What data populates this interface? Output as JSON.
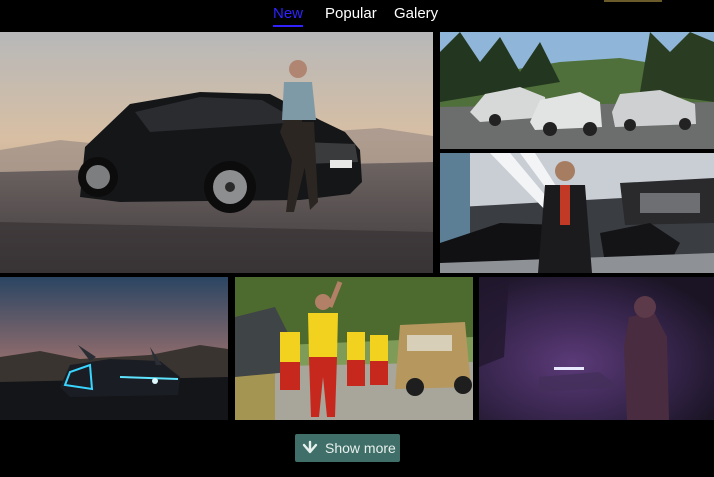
{
  "nav": {
    "tabs": [
      {
        "label": "New",
        "active": true
      },
      {
        "label": "Popular",
        "active": false
      },
      {
        "label": "Galery",
        "active": false
      }
    ],
    "active_color": "#2f22ff"
  },
  "gallery": {
    "tiles": [
      {
        "subject": "black SUV coupe with man leaning on it at sunset",
        "plate": "S MB 2020"
      },
      {
        "subject": "three camouflaged prototype cars on a mountain road"
      },
      {
        "subject": "man in black jacket in a car showroom"
      },
      {
        "subject": "concept car with glowing blue lights at dusk"
      },
      {
        "subject": "rescue team in yellow taking a selfie with an off-road vehicle",
        "plate": "S MB 6080"
      },
      {
        "subject": "person in purple misty forest with a car in the distance"
      }
    ]
  },
  "footer": {
    "show_more_label": "Show more",
    "show_more_icon": "arrow-down-icon",
    "button_color": "#3f6f68"
  }
}
